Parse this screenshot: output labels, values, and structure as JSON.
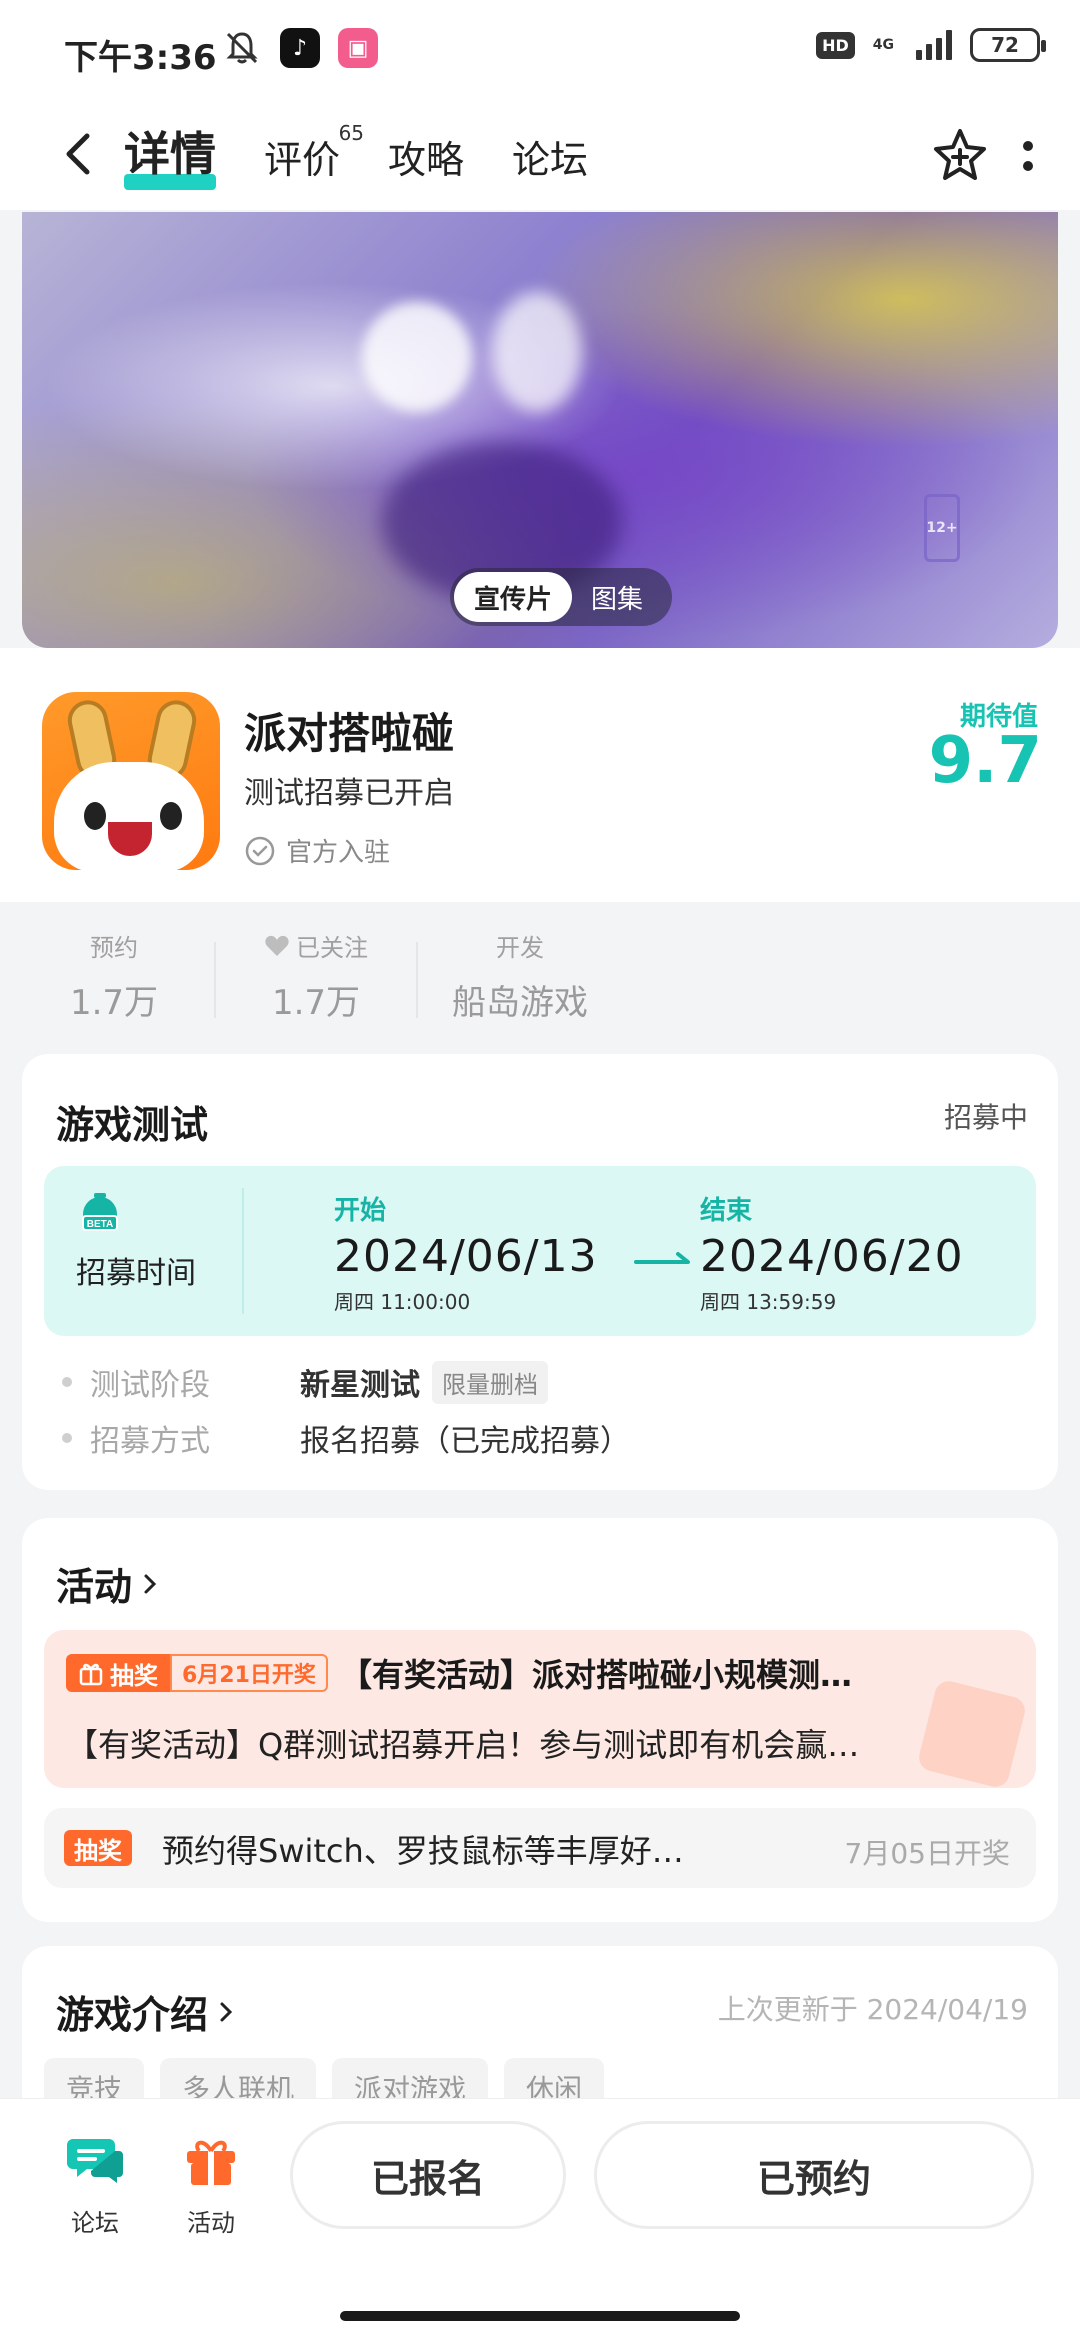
{
  "status_bar": {
    "time": "下午3:36",
    "hd": "HD",
    "network": "4G",
    "battery": "72"
  },
  "nav": {
    "tabs": [
      {
        "label": "详情",
        "active": true
      },
      {
        "label": "评价",
        "badge": "65"
      },
      {
        "label": "攻略"
      },
      {
        "label": "论坛"
      }
    ]
  },
  "banner": {
    "media_tabs": [
      "宣传片",
      "图集"
    ],
    "age_rating": "12+"
  },
  "game": {
    "name": "派对搭啦碰",
    "status": "测试招募已开启",
    "official": "官方入驻",
    "expect_label": "期待值",
    "expect_value": "9.7"
  },
  "stats": [
    {
      "label": "预约",
      "value": "1.7万"
    },
    {
      "label": "已关注",
      "value": "1.7万"
    },
    {
      "label": "开发",
      "value": "船岛游戏"
    }
  ],
  "test": {
    "title": "游戏测试",
    "status": "招募中",
    "time_label": "招募时间",
    "beta": "BETA",
    "start_label": "开始",
    "start_date": "2024/06/13",
    "start_sub": "周四  11:00:00",
    "end_label": "结束",
    "end_date": "2024/06/20",
    "end_sub": "周四  13:59:59",
    "rows": [
      {
        "key": "测试阶段",
        "value": "新星测试",
        "tag": "限量删档"
      },
      {
        "key": "招募方式",
        "value": "报名招募（已完成招募）"
      }
    ]
  },
  "activity": {
    "title": "活动",
    "featured": {
      "badge": "抽奖",
      "date": "6月21日开奖",
      "title": "【有奖活动】派对搭啦碰小规模测…",
      "desc": "【有奖活动】Q群测试招募开启！参与测试即有机会赢…"
    },
    "item": {
      "badge": "抽奖",
      "text": "预约得Switch、罗技鼠标等丰厚好…",
      "date": "7月05日开奖"
    }
  },
  "intro": {
    "title": "游戏介绍",
    "updated": "上次更新于 2024/04/19",
    "tags": [
      "竞技",
      "多人联机",
      "派对游戏",
      "休闲"
    ]
  },
  "bottom": {
    "forum": "论坛",
    "activity": "活动",
    "registered": "已报名",
    "reserved": "已预约"
  },
  "colors": {
    "accent": "#1fd1c2",
    "lottery": "#ff6a2c"
  }
}
